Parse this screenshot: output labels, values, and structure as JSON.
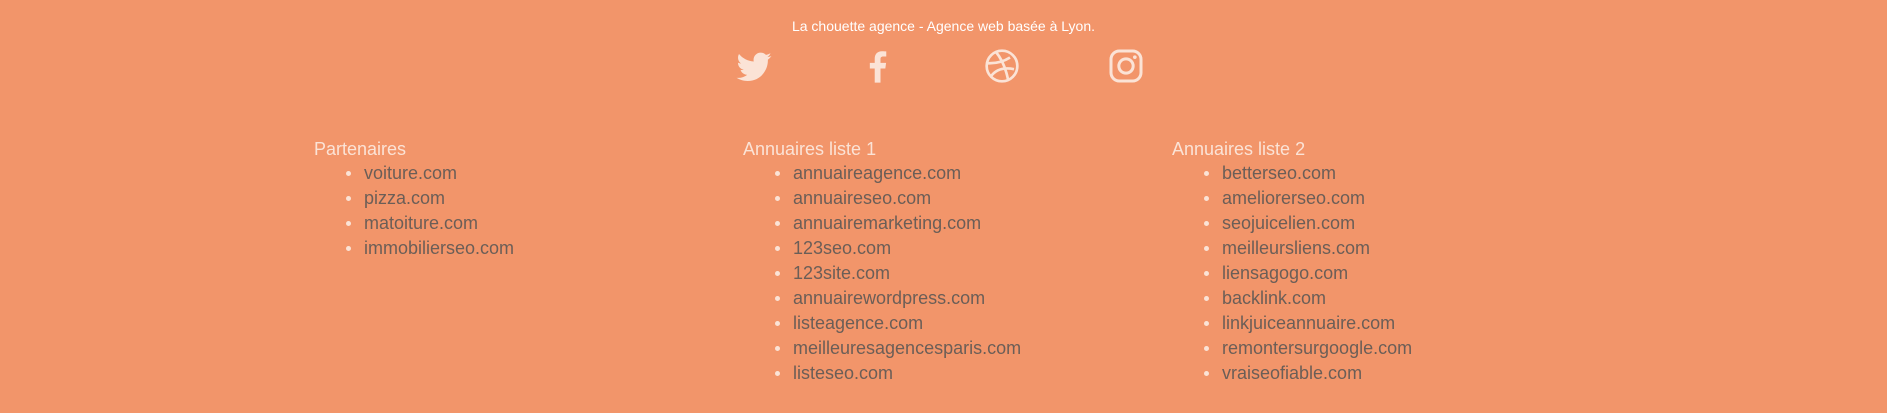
{
  "tagline": "La chouette agence - Agence web basée à Lyon.",
  "socials": [
    {
      "icon": "twitter-icon"
    },
    {
      "icon": "facebook-icon"
    },
    {
      "icon": "dribbble-icon"
    },
    {
      "icon": "instagram-icon"
    }
  ],
  "colors": {
    "background": "#f2956a",
    "icon": "#fbe3d6",
    "link": "#6b5e57",
    "heading": "#fbe3d6"
  },
  "columns": [
    {
      "title": "Partenaires",
      "links": [
        "voiture.com",
        "pizza.com",
        "matoiture.com",
        "immobilierseo.com"
      ]
    },
    {
      "title": "Annuaires liste 1",
      "links": [
        "annuaireagence.com",
        "annuaireseo.com",
        "annuairemarketing.com",
        "123seo.com",
        "123site.com",
        "annuairewordpress.com",
        "listeagence.com",
        "meilleuresagencesparis.com",
        "listeseo.com"
      ]
    },
    {
      "title": "Annuaires liste 2",
      "links": [
        "betterseo.com",
        "ameliorerseo.com",
        "seojuicelien.com",
        "meilleursliens.com",
        "liensagogo.com",
        "backlink.com",
        "linkjuiceannuaire.com",
        "remontersurgoogle.com",
        "vraiseofiable.com"
      ]
    }
  ]
}
